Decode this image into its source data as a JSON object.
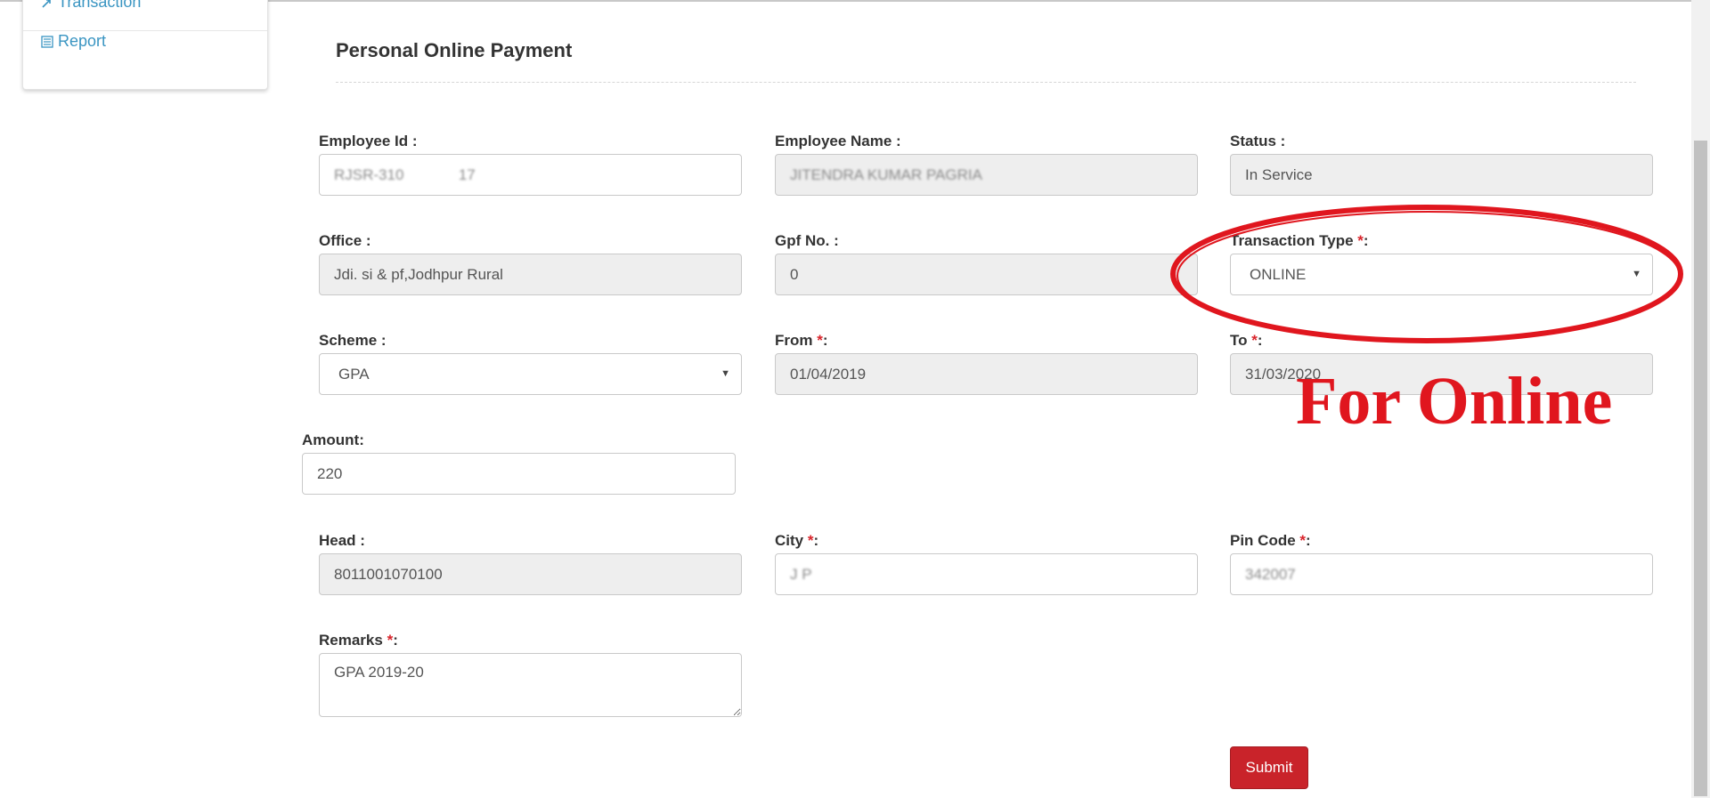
{
  "sidebar": {
    "items": [
      {
        "label": "Transaction",
        "icon": "transaction-icon"
      },
      {
        "label": "Report",
        "icon": "list-icon"
      }
    ]
  },
  "page": {
    "title": "Personal Online Payment"
  },
  "form": {
    "employee_id": {
      "label": "Employee Id :",
      "value": "RJSR-310             17"
    },
    "employee_name": {
      "label": "Employee Name :",
      "value": "JITENDRA KUMAR PAGRIA"
    },
    "status": {
      "label": "Status :",
      "value": "In Service"
    },
    "office": {
      "label": "Office :",
      "value": "Jdi. si & pf,Jodhpur Rural"
    },
    "gpf_no": {
      "label": "Gpf No. :",
      "value": "0"
    },
    "transaction_type": {
      "label": "Transaction Type ",
      "required": "*",
      "suffix": ":",
      "value": "ONLINE"
    },
    "scheme": {
      "label": "Scheme :",
      "value": "GPA"
    },
    "from": {
      "label": "From ",
      "required": "*",
      "suffix": ":",
      "value": "01/04/2019"
    },
    "to": {
      "label": "To ",
      "required": "*",
      "suffix": ":",
      "value": "31/03/2020"
    },
    "amount": {
      "label": "Amount:",
      "value": "220"
    },
    "head": {
      "label": "Head :",
      "value": "8011001070100"
    },
    "city": {
      "label": "City ",
      "required": "*",
      "suffix": ":",
      "value": "J P"
    },
    "pin_code": {
      "label": "Pin Code ",
      "required": "*",
      "suffix": ":",
      "value": "342007"
    },
    "remarks": {
      "label": "Remarks ",
      "required": "*",
      "suffix": ":",
      "value": "GPA 2019-20"
    },
    "submit_label": "Submit"
  },
  "annotation": {
    "text": "For Online",
    "color": "#e0161e"
  },
  "colors": {
    "accent_link": "#3a95c2",
    "submit": "#c9232a",
    "required": "#d9242b",
    "readonly_bg": "#eeeeee"
  }
}
